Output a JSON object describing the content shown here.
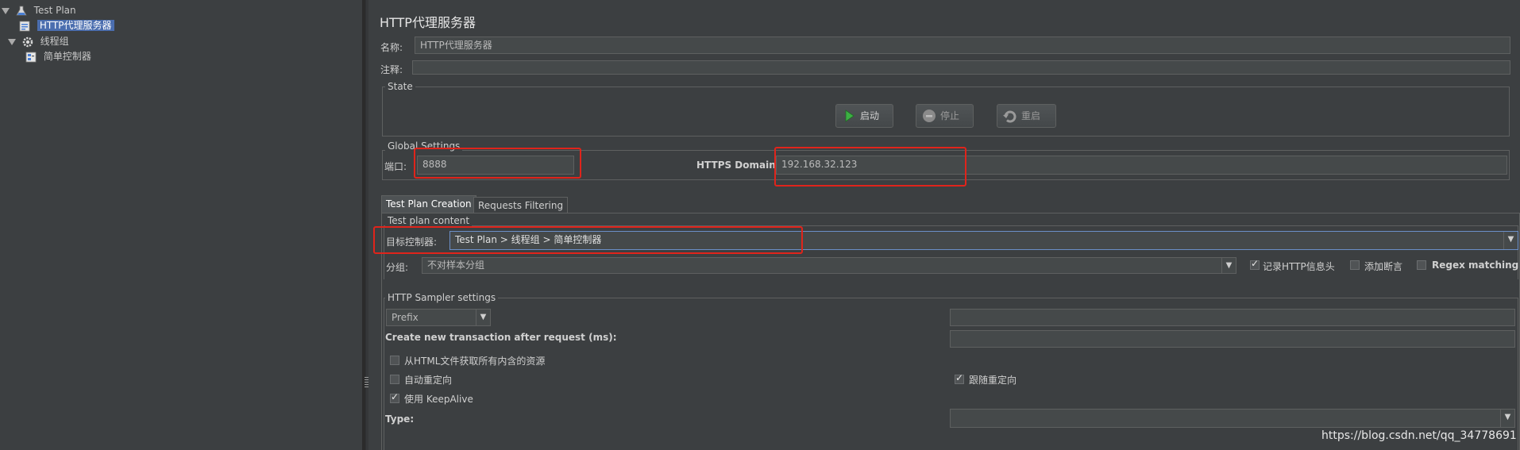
{
  "tree": {
    "items": [
      {
        "label": "Test Plan",
        "icon": "flask-icon"
      },
      {
        "label": "HTTP代理服务器",
        "icon": "proxy-icon"
      },
      {
        "label": "线程组",
        "icon": "gear-icon"
      },
      {
        "label": "简单控制器",
        "icon": "controller-icon"
      }
    ]
  },
  "main": {
    "title": "HTTP代理服务器",
    "name_label": "名称:",
    "name_value": "HTTP代理服务器",
    "comment_label": "注释:",
    "comment_value": ""
  },
  "state": {
    "legend": "State",
    "start_label": "启动",
    "stop_label": "停止",
    "restart_label": "重启"
  },
  "global": {
    "legend": "Global Settings",
    "port_label": "端口:",
    "port_value": "8888",
    "https_label": "HTTPS Domains:",
    "https_value": "192.168.32.123"
  },
  "tabs": [
    {
      "label": "Test Plan Creation",
      "active": true
    },
    {
      "label": "Requests Filtering",
      "active": false
    }
  ],
  "test_plan": {
    "legend": "Test plan content",
    "target_label": "目标控制器:",
    "target_value": "Test Plan > 线程组 > 简单控制器",
    "group_label": "分组:",
    "group_value": "不对样本分组",
    "record_headers_label": "记录HTTP信息头",
    "record_headers_checked": true,
    "add_assertions_label": "添加断言",
    "add_assertions_checked": false,
    "regex_label": "Regex matching",
    "regex_checked": false
  },
  "sampler": {
    "legend": "HTTP Sampler settings",
    "prefix_value": "Prefix",
    "prefix_text": "",
    "transaction_label": "Create new transaction after request (ms):",
    "transaction_value": "",
    "fetch_resources_label": "从HTML文件获取所有内含的资源",
    "fetch_resources_checked": false,
    "auto_redirect_label": "自动重定向",
    "auto_redirect_checked": false,
    "keepalive_label": "使用 KeepAlive",
    "keepalive_checked": true,
    "follow_redirect_label": "跟随重定向",
    "follow_redirect_checked": true,
    "type_label": "Type:",
    "type_value": ""
  },
  "watermark": "https://blog.csdn.net/qq_34778691",
  "colors": {
    "background": "#3c3f41",
    "selection": "#4b6eaf",
    "highlight_box": "#e0241b",
    "focus_border": "#6b8fc7"
  }
}
